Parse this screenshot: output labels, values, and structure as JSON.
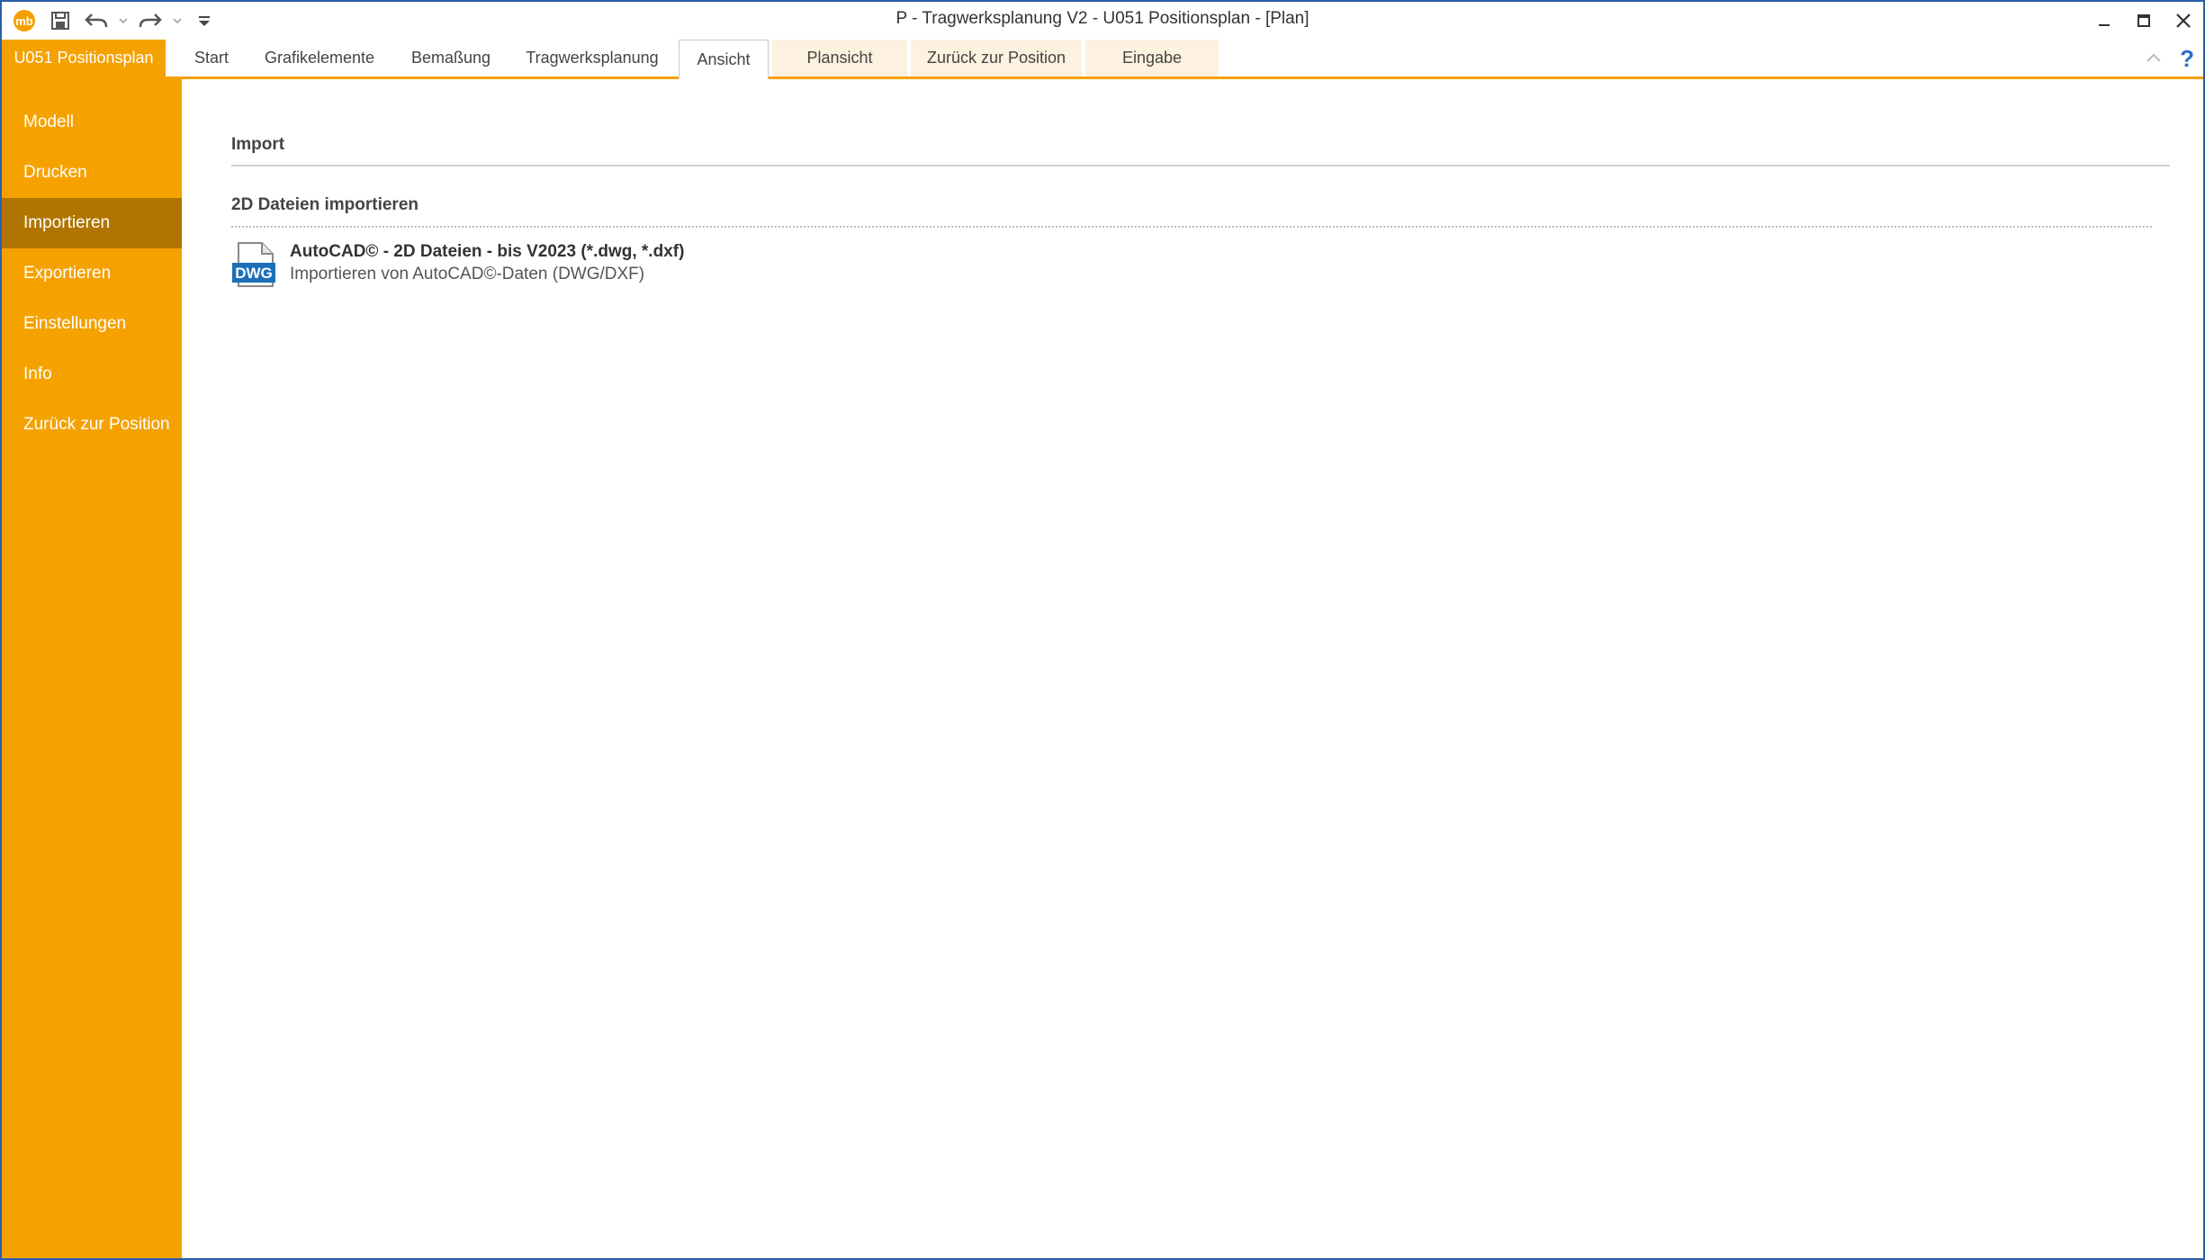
{
  "window": {
    "title": "P - Tragwerksplanung V2 - U051 Positionsplan - [Plan]"
  },
  "ribbon": {
    "file_tab": "U051 Positionsplan",
    "tabs": [
      {
        "label": "Start"
      },
      {
        "label": "Grafikelemente"
      },
      {
        "label": "Bemaßung"
      },
      {
        "label": "Tragwerksplanung"
      },
      {
        "label": "Ansicht"
      },
      {
        "label": "Plansicht"
      },
      {
        "label": "Zurück zur Position"
      },
      {
        "label": "Eingabe"
      }
    ],
    "help_label": "?"
  },
  "sidebar": {
    "items": [
      {
        "label": "Modell"
      },
      {
        "label": "Drucken"
      },
      {
        "label": "Importieren"
      },
      {
        "label": "Exportieren"
      },
      {
        "label": "Einstellungen"
      },
      {
        "label": "Info"
      },
      {
        "label": "Zurück zur Position"
      }
    ],
    "selected": "Importieren"
  },
  "main": {
    "section_title": "Import",
    "group_title": "2D Dateien importieren",
    "command": {
      "title": "AutoCAD© - 2D Dateien - bis V2023 (*.dwg, *.dxf)",
      "description": "Importieren von AutoCAD©-Daten (DWG/DXF)",
      "icon_label": "DWG"
    }
  },
  "colors": {
    "accent": "#f5a100",
    "sidebar_selected": "#b07500",
    "contextual_tab": "#fdf1df",
    "window_border": "#2b5ea7",
    "dwg_blue": "#1d6fb8"
  }
}
